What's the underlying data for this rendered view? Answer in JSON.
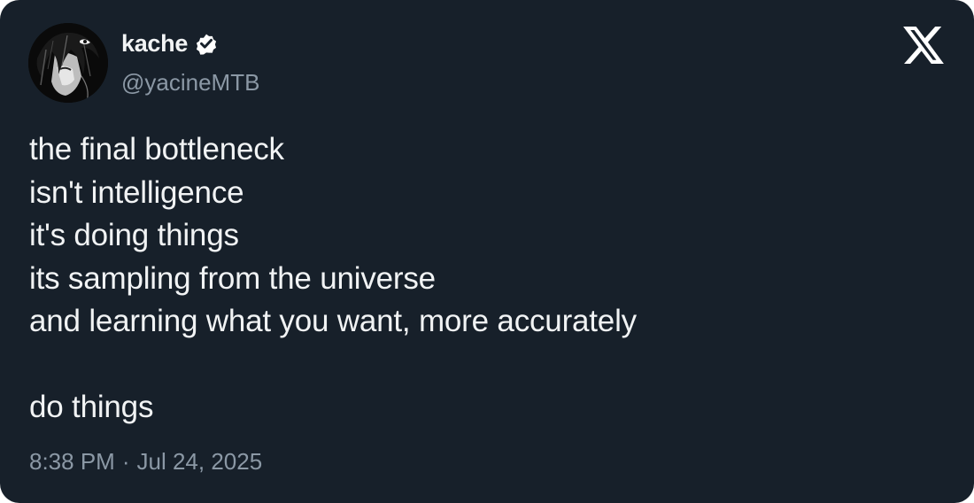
{
  "author": {
    "display_name": "kache",
    "handle": "@yacineMTB",
    "verified": true,
    "avatar_icon": "anime-avatar-icon",
    "verified_icon": "verified-badge-icon"
  },
  "platform_icon": "x-logo-icon",
  "tweet": {
    "lines": [
      "the final bottleneck",
      "isn't intelligence",
      "it's doing things",
      "its sampling from the universe",
      "and learning what you want, more accurately",
      "",
      "do things"
    ]
  },
  "meta": {
    "time": "8:38 PM",
    "separator": "·",
    "date": "Jul 24, 2025"
  },
  "colors": {
    "background": "#17202a",
    "text": "#e7e9ea",
    "secondary_text": "#8b98a5"
  }
}
